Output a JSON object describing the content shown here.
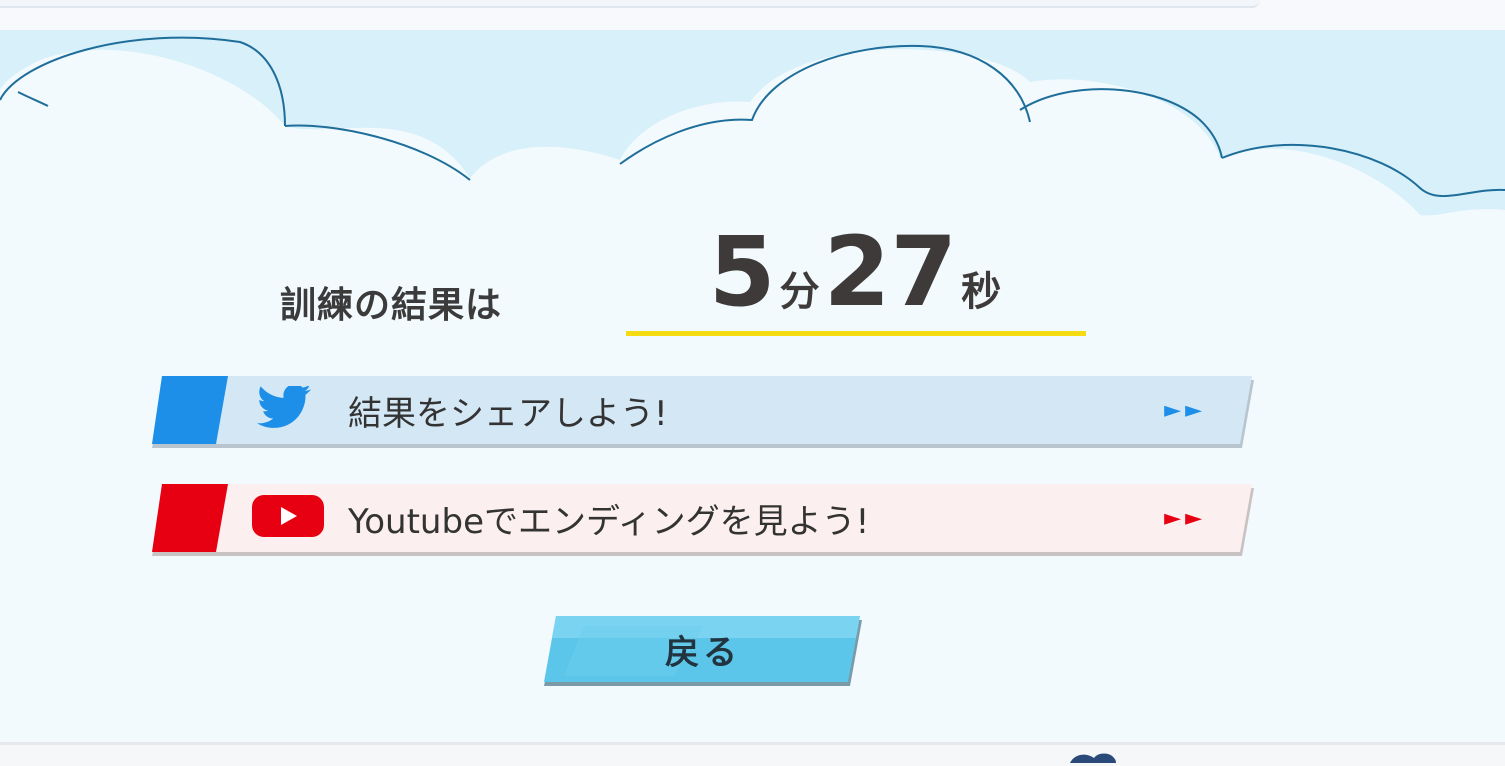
{
  "result": {
    "label": "訓練の結果は",
    "minutes": "5",
    "minutes_unit": "分",
    "seconds": "27",
    "seconds_unit": "秒"
  },
  "share": {
    "twitter_label": "結果をシェアしよう!",
    "twitter_icon": "twitter-bird-icon",
    "twitter_color": "#1d8fe8",
    "twitter_bg": "#d3e7f4",
    "youtube_label": "Youtubeでエンディングを見よう!",
    "youtube_icon": "youtube-play-icon",
    "youtube_color": "#e60012",
    "youtube_bg": "#fcefef",
    "arrows": "►►"
  },
  "back_button": {
    "label": "戻る",
    "color": "#5cc6ea"
  },
  "accent": {
    "underline": "#f5dc12",
    "cloud": "#d7f0fa",
    "cloud_outline": "#1f6e9a"
  }
}
